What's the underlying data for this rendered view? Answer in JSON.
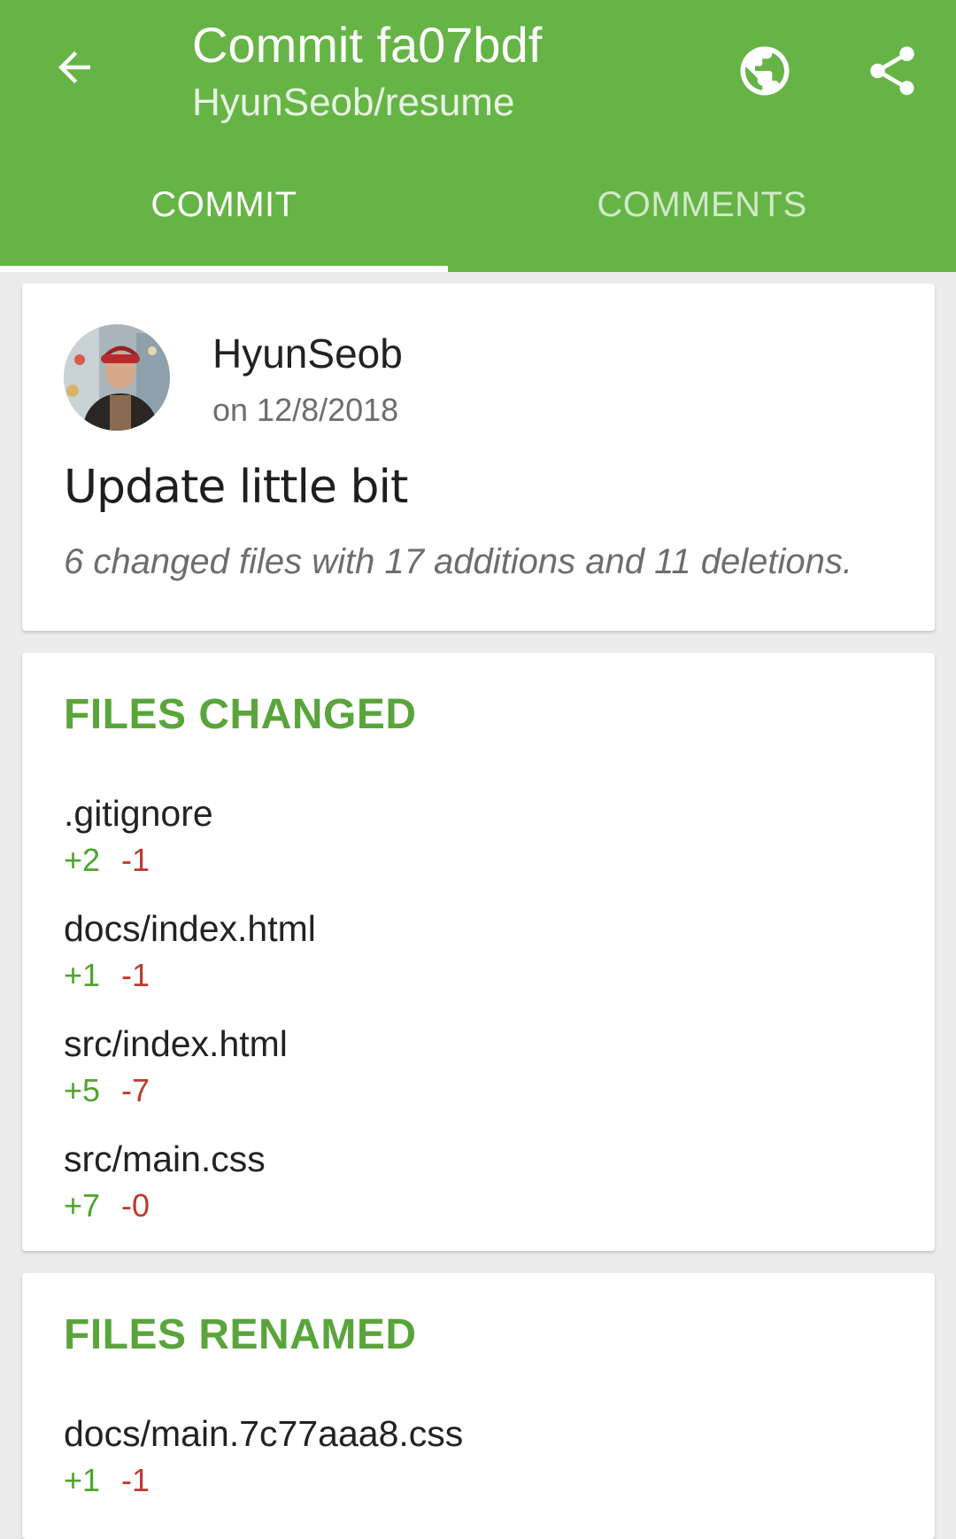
{
  "appbar": {
    "title": "Commit fa07bdf",
    "subtitle": "HyunSeob/resume",
    "tabs": [
      {
        "label": "COMMIT",
        "selected": true
      },
      {
        "label": "COMMENTS",
        "selected": false
      }
    ],
    "icons": {
      "back": "arrow-left-icon",
      "browser": "globe-icon",
      "share": "share-icon"
    }
  },
  "commit": {
    "author": "HyunSeob",
    "date": "on 12/8/2018",
    "message": "Update little bit",
    "summary": "6 changed files with 17 additions and 11 deletions."
  },
  "files_changed": {
    "title": "FILES CHANGED",
    "files": [
      {
        "name": ".gitignore",
        "additions": "+2",
        "deletions": "-1"
      },
      {
        "name": "docs/index.html",
        "additions": "+1",
        "deletions": "-1"
      },
      {
        "name": "src/index.html",
        "additions": "+5",
        "deletions": "-7"
      },
      {
        "name": "src/main.css",
        "additions": "+7",
        "deletions": "-0"
      }
    ]
  },
  "files_renamed": {
    "title": "FILES RENAMED",
    "files": [
      {
        "name": "docs/main.7c77aaa8.css",
        "additions": "+1",
        "deletions": "-1"
      }
    ]
  },
  "colors": {
    "primary": "#66b446",
    "accent": "#5aa53b",
    "addition": "#4ea52d",
    "deletion": "#c0392b"
  }
}
